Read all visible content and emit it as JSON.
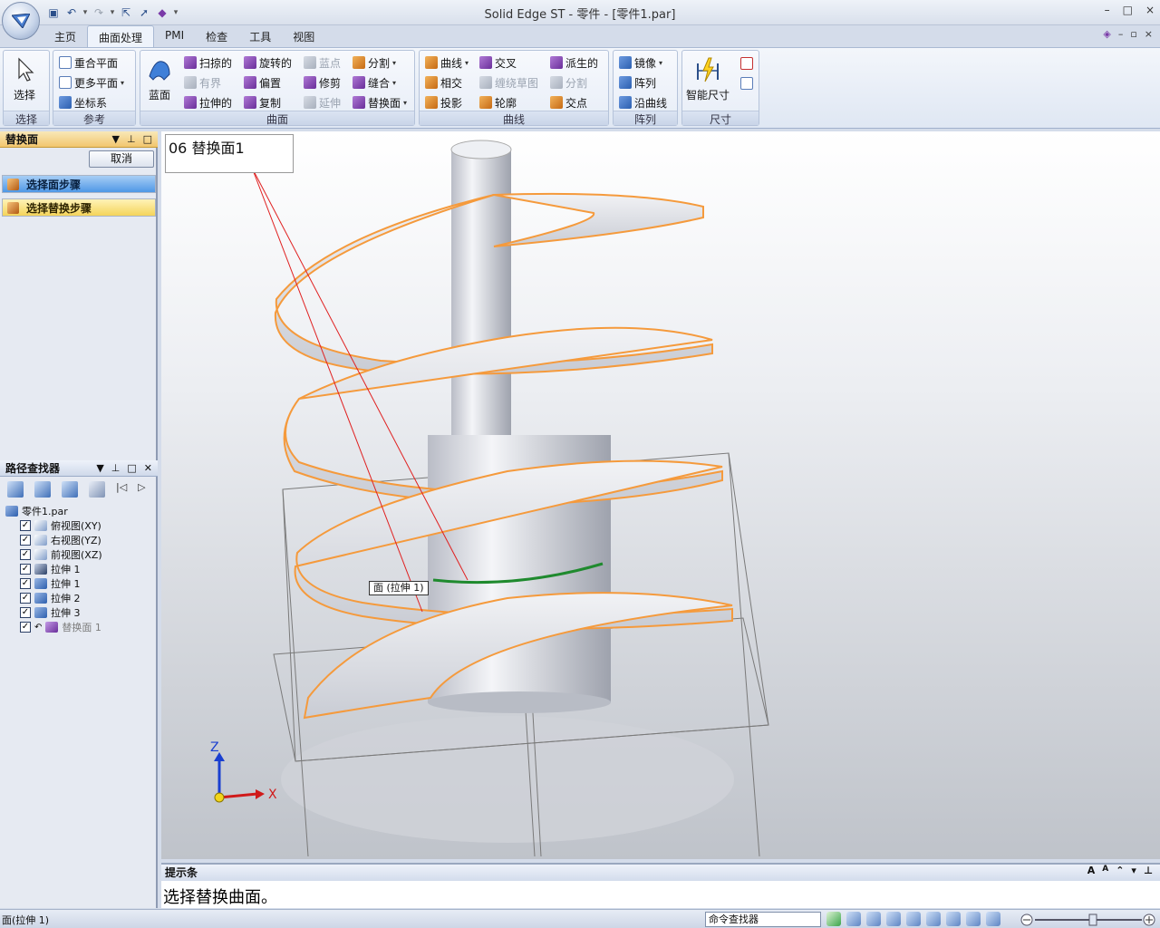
{
  "app": {
    "title": "Solid Edge ST - 零件 - [零件1.par]",
    "window_controls": [
      "–",
      "□",
      "×"
    ]
  },
  "quick_access": {
    "icons": [
      "save-icon",
      "undo-icon",
      "redo-icon",
      "select-icon",
      "cursor-icon",
      "part-icon"
    ]
  },
  "tabs": [
    {
      "label": "主页"
    },
    {
      "label": "曲面处理",
      "active": true
    },
    {
      "label": "PMI"
    },
    {
      "label": "检查"
    },
    {
      "label": "工具"
    },
    {
      "label": "视图"
    }
  ],
  "tabs_right": [
    "–",
    "▫",
    "×"
  ],
  "ribbon": {
    "select": {
      "label": "选择",
      "group": "选择"
    },
    "reference": {
      "group": "参考",
      "items": [
        "重合平面",
        "更多平面",
        "坐标系"
      ]
    },
    "surface": {
      "group": "曲面",
      "blue_surface": "蓝面",
      "col1": [
        "扫掠的",
        "有界",
        "拉伸的"
      ],
      "col2": [
        "旋转的",
        "偏置",
        "复制"
      ],
      "col3": [
        "蓝点",
        "修剪",
        "延伸"
      ],
      "col4": [
        "分割",
        "缝合",
        "替换面"
      ]
    },
    "curves": {
      "group": "曲线",
      "col1": [
        "曲线",
        "相交",
        "投影"
      ],
      "col2": [
        "交叉",
        "缠绕草图",
        "轮廓"
      ],
      "col3": [
        "派生的",
        "分割",
        "交点"
      ]
    },
    "pattern": {
      "group": "阵列",
      "items": [
        "镜像",
        "阵列",
        "沿曲线"
      ]
    },
    "dimension": {
      "group": "尺寸",
      "smart": "智能尺寸"
    }
  },
  "replace_panel": {
    "title": "替换面",
    "cancel": "取消",
    "step1": "选择面步骤",
    "step2": "选择替换步骤"
  },
  "pathfinder": {
    "title": "路径查找器",
    "root": "零件1.par",
    "items": [
      {
        "label": "俯视图(XY)",
        "checked": true,
        "icon": "plane-icon"
      },
      {
        "label": "右视图(YZ)",
        "checked": true,
        "icon": "plane-icon"
      },
      {
        "label": "前视图(XZ)",
        "checked": true,
        "icon": "plane-icon"
      },
      {
        "label": "拉伸 1",
        "checked": true,
        "icon": "surface-extrude-icon"
      },
      {
        "label": "拉伸 1",
        "checked": true,
        "icon": "extrude-icon"
      },
      {
        "label": "拉伸 2",
        "checked": true,
        "icon": "extrude-icon"
      },
      {
        "label": "拉伸 3",
        "checked": true,
        "icon": "extrude-icon"
      },
      {
        "label": "替换面 1",
        "checked": true,
        "icon": "replace-face-icon",
        "dim": true
      }
    ]
  },
  "viewport": {
    "step_label": "06 替换面1",
    "face_tooltip": "面 (拉伸 1)",
    "axis_z": "Z",
    "axis_x": "X"
  },
  "prompt": {
    "title": "提示条",
    "text": "选择替换曲面。",
    "controls": [
      "A",
      "A",
      "⌃",
      "▾",
      "⊥"
    ]
  },
  "status": {
    "text": "面(拉伸 1)",
    "command_finder": "命令查找器"
  }
}
